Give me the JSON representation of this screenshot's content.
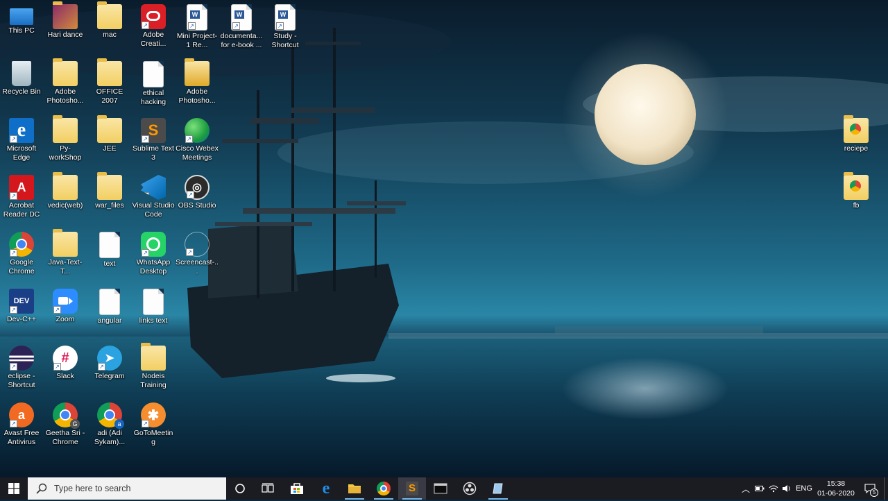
{
  "desktop": {
    "icons": [
      {
        "label": "This PC",
        "icon": "this-pc-icon"
      },
      {
        "label": "Hari dance",
        "icon": "folder-icon"
      },
      {
        "label": "mac",
        "icon": "folder-icon"
      },
      {
        "label": "Adobe Creati...",
        "icon": "adobe-cc-icon"
      },
      {
        "label": "Mini Project-1 Re...",
        "icon": "word-doc-icon"
      },
      {
        "label": "documenta... for e-book ...",
        "icon": "word-doc-icon"
      },
      {
        "label": "Study - Shortcut",
        "icon": "word-doc-icon"
      },
      {
        "label": "Recycle Bin",
        "icon": "recycle-bin-icon"
      },
      {
        "label": "Adobe Photosho...",
        "icon": "folder-icon"
      },
      {
        "label": "OFFICE 2007",
        "icon": "folder-icon"
      },
      {
        "label": "ethical hacking",
        "icon": "text-doc-icon"
      },
      {
        "label": "Adobe Photosho...",
        "icon": "folder-icon"
      },
      {
        "label": "Microsoft Edge",
        "icon": "edge-icon"
      },
      {
        "label": "Py-workShop",
        "icon": "folder-icon"
      },
      {
        "label": "JEE",
        "icon": "folder-icon"
      },
      {
        "label": "Sublime Text 3",
        "icon": "sublime-icon"
      },
      {
        "label": "Cisco Webex Meetings",
        "icon": "webex-icon"
      },
      {
        "label": "Acrobat Reader DC",
        "icon": "acrobat-icon"
      },
      {
        "label": "vedic(web)",
        "icon": "folder-icon"
      },
      {
        "label": "war_files",
        "icon": "folder-icon"
      },
      {
        "label": "Visual Studio Code",
        "icon": "vscode-icon"
      },
      {
        "label": "OBS Studio",
        "icon": "obs-icon"
      },
      {
        "label": "Google Chrome",
        "icon": "chrome-icon"
      },
      {
        "label": "Java-Text-T...",
        "icon": "folder-icon"
      },
      {
        "label": "text",
        "icon": "text-doc-icon"
      },
      {
        "label": "WhatsApp Desktop",
        "icon": "whatsapp-icon"
      },
      {
        "label": "Screencast-...",
        "icon": "screencast-icon"
      },
      {
        "label": "Dev-C++",
        "icon": "devcpp-icon"
      },
      {
        "label": "Zoom",
        "icon": "zoom-icon"
      },
      {
        "label": "angular",
        "icon": "text-doc-icon"
      },
      {
        "label": "links text",
        "icon": "text-doc-icon"
      },
      {
        "label": "eclipse - Shortcut",
        "icon": "eclipse-icon"
      },
      {
        "label": "Slack",
        "icon": "slack-icon"
      },
      {
        "label": "Telegram",
        "icon": "telegram-icon"
      },
      {
        "label": "Nodeis Training",
        "icon": "folder-icon"
      },
      {
        "label": "Avast Free Antivirus",
        "icon": "avast-icon"
      },
      {
        "label": "Geetha Sri - Chrome",
        "icon": "chrome-profile-icon"
      },
      {
        "label": "adi (Adi Sykam)...",
        "icon": "chrome-profile-icon"
      },
      {
        "label": "GoToMeeting",
        "icon": "gotomeeting-icon"
      },
      {
        "label": "reciepe",
        "icon": "chrome-folder-icon"
      },
      {
        "label": "fb",
        "icon": "chrome-folder-icon"
      }
    ]
  },
  "taskbar": {
    "search_placeholder": "Type here to search",
    "pinned": [
      "cortana-icon",
      "task-view-icon",
      "store-icon",
      "edge-icon",
      "file-explorer-icon",
      "chrome-icon",
      "sublime-icon",
      "terminal-icon",
      "obs-icon",
      "notepad-icon"
    ],
    "language": "ENG",
    "time": "15:38",
    "date": "01-06-2020",
    "notification_count": "5"
  },
  "colors": {
    "taskbar_bg": "#1b1b22",
    "accent_underline": "#76b9ed"
  }
}
